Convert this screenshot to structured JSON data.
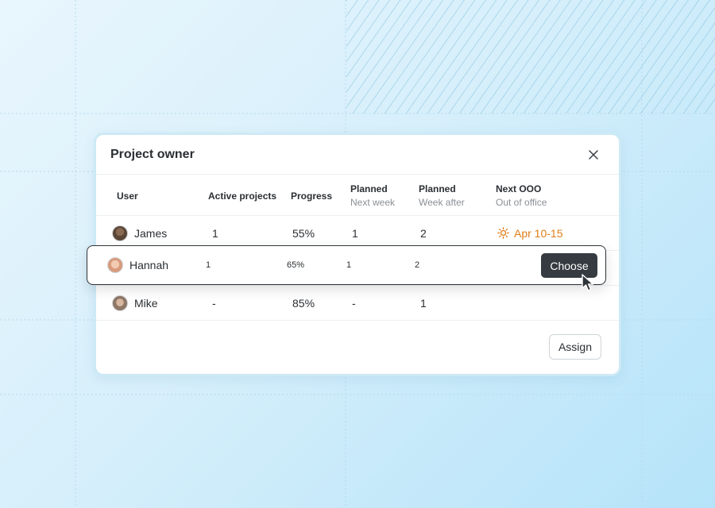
{
  "dialog": {
    "title": "Project owner",
    "close_icon": "close-icon"
  },
  "columns": {
    "user": "User",
    "active": "Active projects",
    "progress": "Progress",
    "planned1": "Planned",
    "planned1_sub": "Next week",
    "planned2": "Planned",
    "planned2_sub": "Week after",
    "ooo": "Next OOO",
    "ooo_sub": "Out of office"
  },
  "rows": [
    {
      "name": "James",
      "active": "1",
      "progress": "55%",
      "next_week": "1",
      "week_after": "2",
      "ooo": "Apr 10-15",
      "ooo_icon": "sun-icon"
    },
    {
      "name": "Hannah",
      "active": "1",
      "progress": "65%",
      "next_week": "1",
      "week_after": "2",
      "action": "Choose"
    },
    {
      "name": "Mike",
      "active": "-",
      "progress": "85%",
      "next_week": "-",
      "week_after": "1"
    }
  ],
  "footer": {
    "assign_label": "Assign"
  },
  "colors": {
    "accent": "#e07d16",
    "choose_bg": "#353b40"
  }
}
